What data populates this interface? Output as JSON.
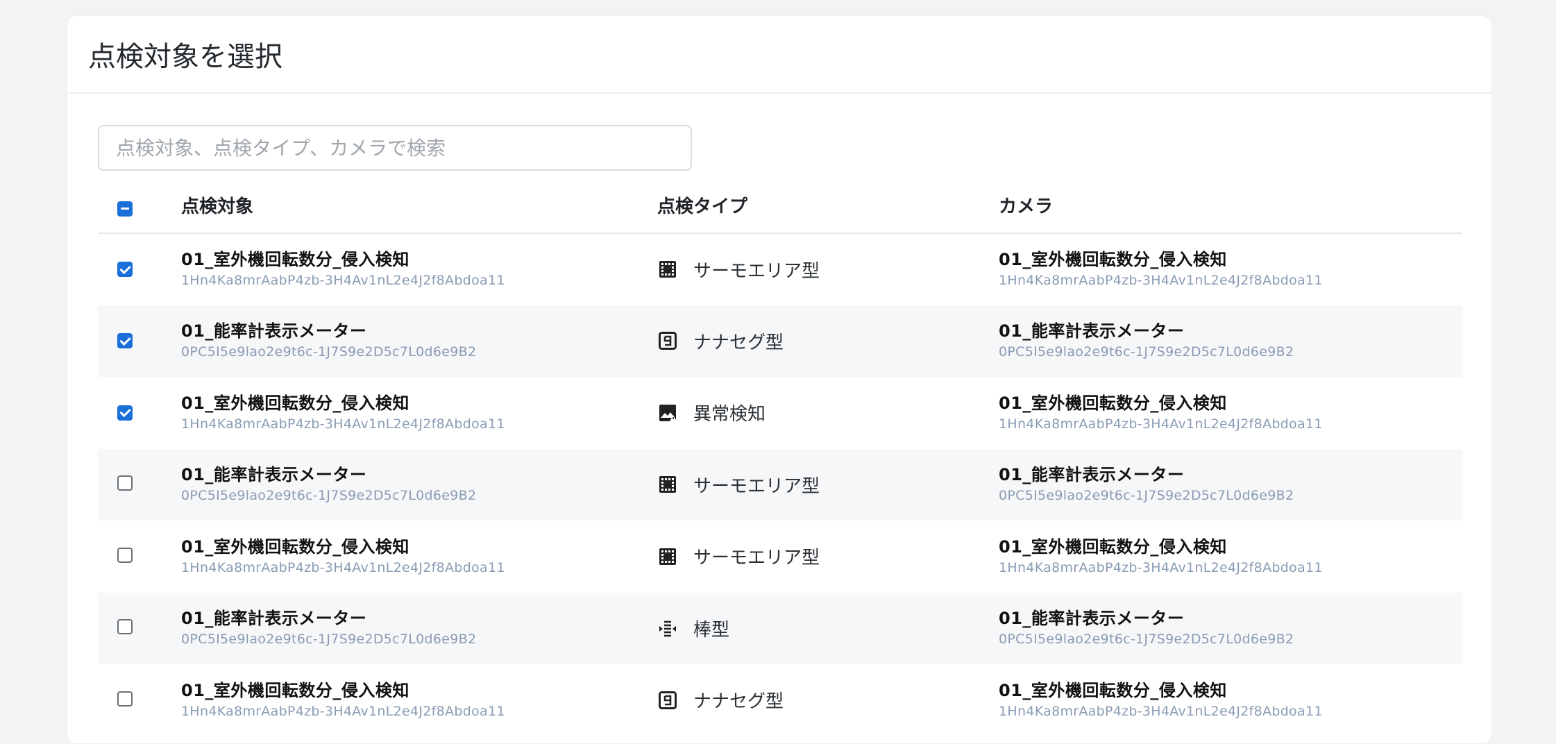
{
  "card": {
    "title": "点検対象を選択"
  },
  "search": {
    "placeholder": "点検対象、点検タイプ、カメラで検索",
    "value": ""
  },
  "table": {
    "header_checkbox_state": "indeterminate",
    "headers": {
      "target": "点検対象",
      "type": "点検タイプ",
      "camera": "カメラ"
    },
    "rows": [
      {
        "checked": true,
        "target": {
          "name": "01_室外機回転数分_侵入検知",
          "id": "1Hn4Ka8mrAabP4zb-3H4Av1nL2e4J2f8Abdoa11"
        },
        "type": {
          "label": "サーモエリア型",
          "icon": "thermo-grid-icon"
        },
        "camera": {
          "name": "01_室外機回転数分_侵入検知",
          "id": "1Hn4Ka8mrAabP4zb-3H4Av1nL2e4J2f8Abdoa11"
        }
      },
      {
        "checked": true,
        "target": {
          "name": "01_能率計表示メーター",
          "id": "0PC5I5e9lao2e9t6c-1J7S9e2D5c7L0d6e9B2"
        },
        "type": {
          "label": "ナナセグ型",
          "icon": "seven-segment-icon"
        },
        "camera": {
          "name": "01_能率計表示メーター",
          "id": "0PC5I5e9lao2e9t6c-1J7S9e2D5c7L0d6e9B2"
        }
      },
      {
        "checked": true,
        "target": {
          "name": "01_室外機回転数分_侵入検知",
          "id": "1Hn4Ka8mrAabP4zb-3H4Av1nL2e4J2f8Abdoa11"
        },
        "type": {
          "label": "異常検知",
          "icon": "anomaly-image-icon"
        },
        "camera": {
          "name": "01_室外機回転数分_侵入検知",
          "id": "1Hn4Ka8mrAabP4zb-3H4Av1nL2e4J2f8Abdoa11"
        }
      },
      {
        "checked": false,
        "target": {
          "name": "01_能率計表示メーター",
          "id": "0PC5I5e9lao2e9t6c-1J7S9e2D5c7L0d6e9B2"
        },
        "type": {
          "label": "サーモエリア型",
          "icon": "thermo-grid-icon"
        },
        "camera": {
          "name": "01_能率計表示メーター",
          "id": "0PC5I5e9lao2e9t6c-1J7S9e2D5c7L0d6e9B2"
        }
      },
      {
        "checked": false,
        "target": {
          "name": "01_室外機回転数分_侵入検知",
          "id": "1Hn4Ka8mrAabP4zb-3H4Av1nL2e4J2f8Abdoa11"
        },
        "type": {
          "label": "サーモエリア型",
          "icon": "thermo-grid-icon"
        },
        "camera": {
          "name": "01_室外機回転数分_侵入検知",
          "id": "1Hn4Ka8mrAabP4zb-3H4Av1nL2e4J2f8Abdoa11"
        }
      },
      {
        "checked": false,
        "target": {
          "name": "01_能率計表示メーター",
          "id": "0PC5I5e9lao2e9t6c-1J7S9e2D5c7L0d6e9B2"
        },
        "type": {
          "label": "棒型",
          "icon": "bar-gauge-icon"
        },
        "camera": {
          "name": "01_能率計表示メーター",
          "id": "0PC5I5e9lao2e9t6c-1J7S9e2D5c7L0d6e9B2"
        }
      },
      {
        "checked": false,
        "target": {
          "name": "01_室外機回転数分_侵入検知",
          "id": "1Hn4Ka8mrAabP4zb-3H4Av1nL2e4J2f8Abdoa11"
        },
        "type": {
          "label": "ナナセグ型",
          "icon": "seven-segment-icon"
        },
        "camera": {
          "name": "01_室外機回転数分_侵入検知",
          "id": "1Hn4Ka8mrAabP4zb-3H4Av1nL2e4J2f8Abdoa11"
        }
      }
    ]
  }
}
